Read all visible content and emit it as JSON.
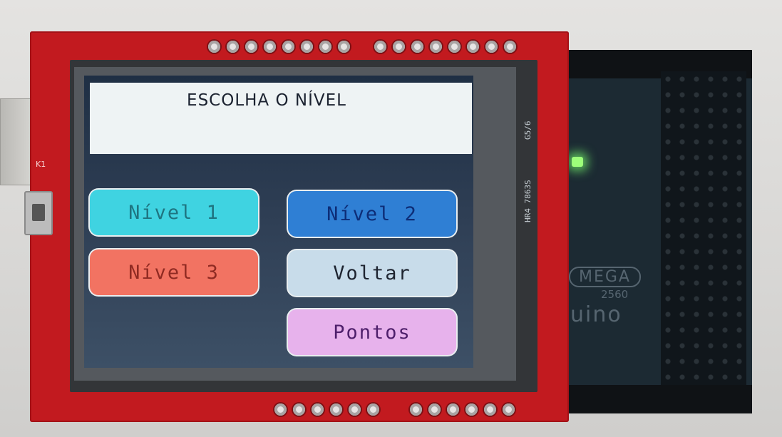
{
  "screen": {
    "title": "ESCOLHA O NÍVEL",
    "buttons": [
      {
        "label": "Nível 1",
        "color": "#3fd3e1"
      },
      {
        "label": "Nível 2",
        "color": "#2f7fd4"
      },
      {
        "label": "Nível 3",
        "color": "#f27362"
      },
      {
        "label": "Voltar",
        "color": "#c8dcea"
      },
      {
        "label": "Pontos",
        "color": "#e7b2ec"
      }
    ]
  },
  "shield": {
    "board_color": "#c21a1f",
    "label_k1": "K1",
    "silk_top": "G5/6",
    "silk_side": "HR4 7863S"
  },
  "board": {
    "logo": "MEGA",
    "model": "2560",
    "brand_partial": "uino",
    "led_color": "#9dff7a"
  }
}
